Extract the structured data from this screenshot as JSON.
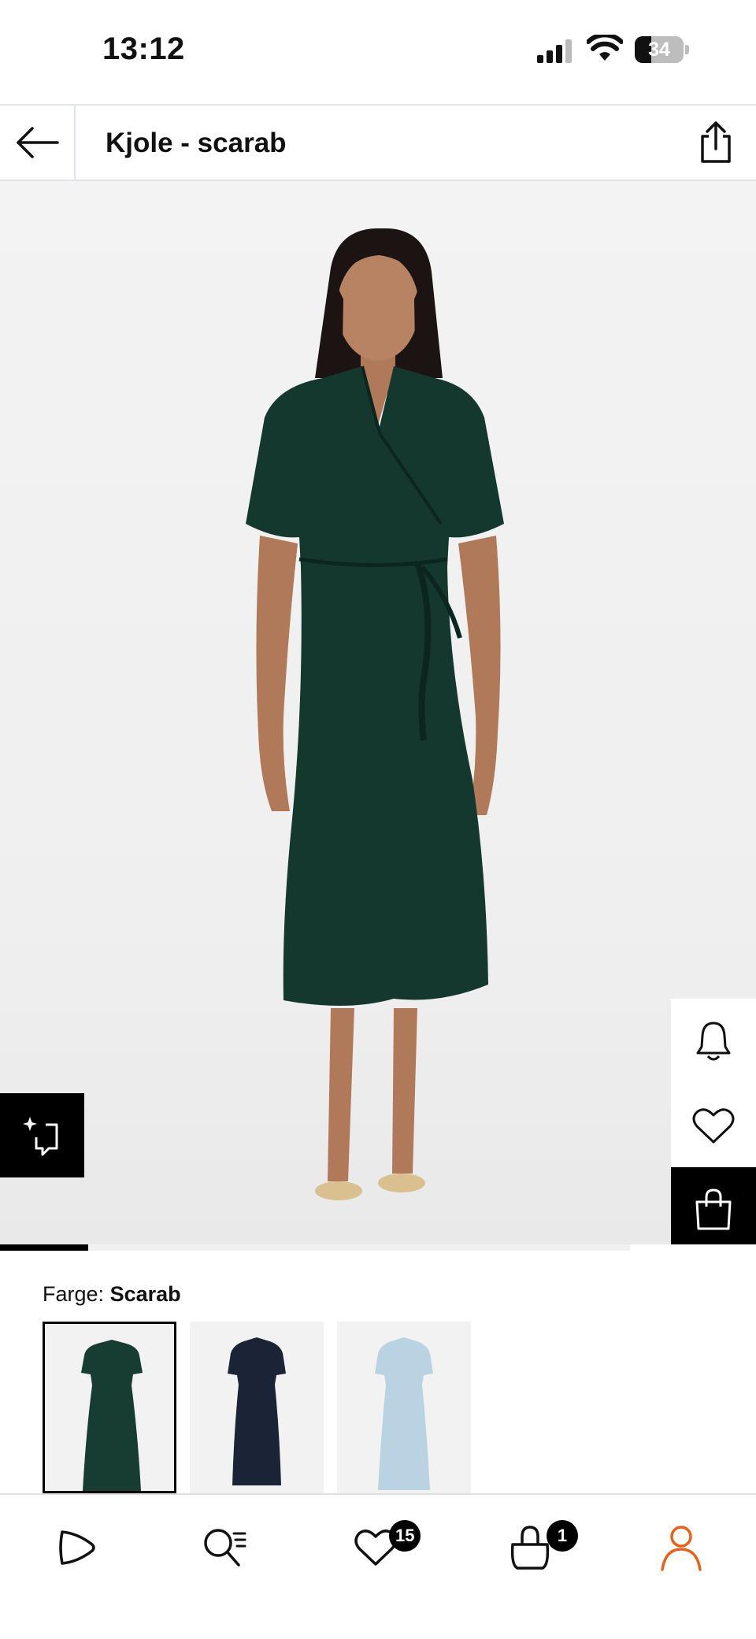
{
  "status_bar": {
    "time": "13:12",
    "battery_percent": 34,
    "battery_text": "34"
  },
  "header": {
    "title": "Kjole - scarab"
  },
  "product": {
    "image_progress": 0.14,
    "dress_color": "#14382d"
  },
  "color_selector": {
    "label": "Farge:",
    "selected_color": "Scarab",
    "swatches": [
      {
        "name": "scarab",
        "color": "#173c31",
        "selected": true
      },
      {
        "name": "navy",
        "color": "#1b2337",
        "selected": false
      },
      {
        "name": "light-blue",
        "color": "#b9d3e2",
        "selected": false
      }
    ]
  },
  "bottom_nav": {
    "favorites_count": "15",
    "cart_count": "1",
    "accent_color": "#e8611a"
  }
}
